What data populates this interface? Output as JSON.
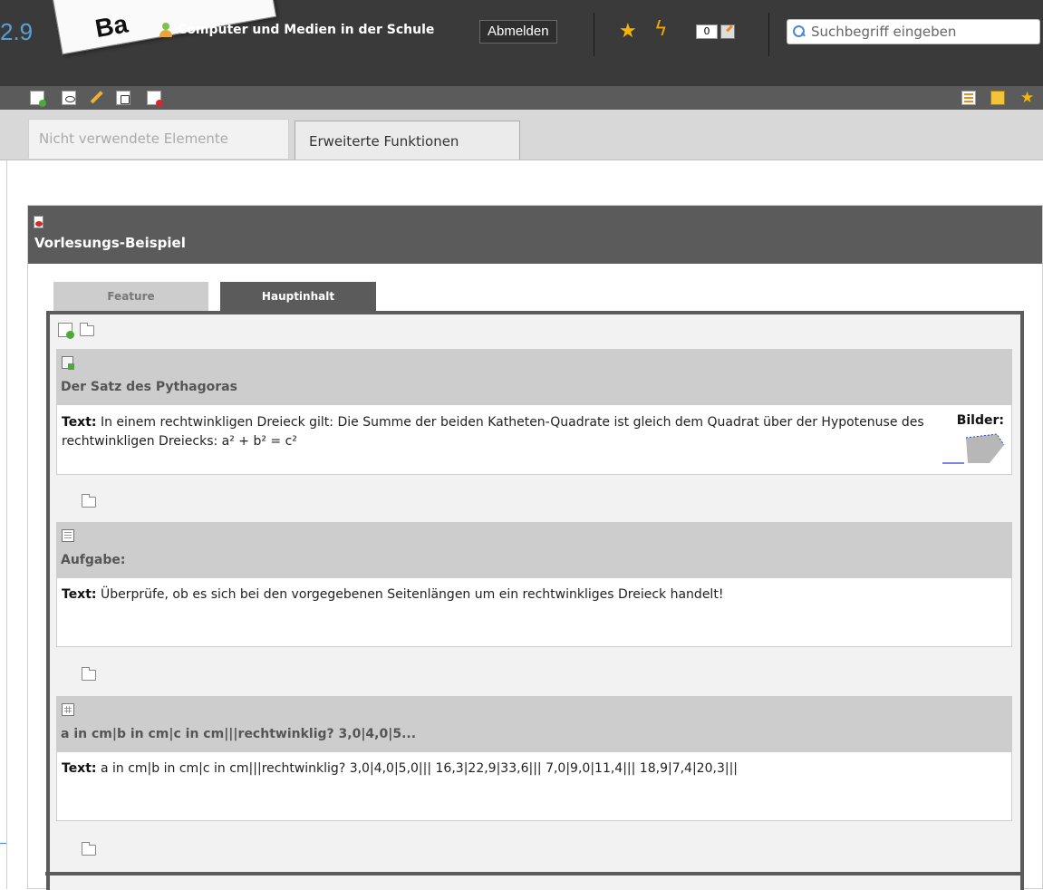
{
  "header": {
    "version_fragment": "2.9",
    "paper_label": "Ba",
    "user_name": "Computer und Medien in der Schule",
    "logout_label": "Abmelden",
    "counter_value": "0",
    "search_placeholder": "Suchbegriff eingeben",
    "icons": [
      "user-icon",
      "star-icon",
      "bolt-icon",
      "notes-icon",
      "search-icon"
    ]
  },
  "toolbar": {
    "left_icons": [
      "new-page-icon",
      "preview-icon",
      "edit-icon",
      "move-page-icon",
      "schedule-icon"
    ],
    "right_icons": [
      "list-icon",
      "mail-icon",
      "add-favorite-icon"
    ]
  },
  "top_tabs": [
    {
      "label": "Nicht verwendete Elemente",
      "active": false
    },
    {
      "label": "Erweiterte Funktionen",
      "active": true
    }
  ],
  "panel": {
    "title": "Vorlesungs-Beispiel",
    "subtabs": [
      {
        "label": "Feature",
        "active": false
      },
      {
        "label": "Hauptinhalt",
        "active": true
      }
    ]
  },
  "blocks": [
    {
      "title": "Der Satz des Pythagoras",
      "text_label": "Text:",
      "text": "In einem rechtwinkligen Dreieck gilt: Die Summe der beiden Katheten-Quadrate ist gleich dem Quadrat über der Hypotenuse des rechtwinkligen Dreiecks: a² + b² = c²",
      "images_label": "Bilder:"
    },
    {
      "title": "Aufgabe:",
      "text_label": "Text:",
      "text": "Überprüfe, ob es sich bei den vorgegebenen Seitenlängen um ein rechtwinkliges Dreieck handelt!"
    },
    {
      "title": "a in cm|b in cm|c in cm|||rechtwinklig? 3,0|4,0|5...",
      "text_label": "Text:",
      "text": "a in cm|b in cm|c in cm|||rechtwinklig? 3,0|4,0|5,0||| 16,3|22,9|33,6||| 7,0|9,0|11,4||| 18,9|7,4|20,3|||"
    }
  ],
  "colors": {
    "topbar": "#3a3a3a",
    "toolbar": "#5b5b5b",
    "block_header": "#cdcdcd",
    "star": "#f5b700"
  }
}
